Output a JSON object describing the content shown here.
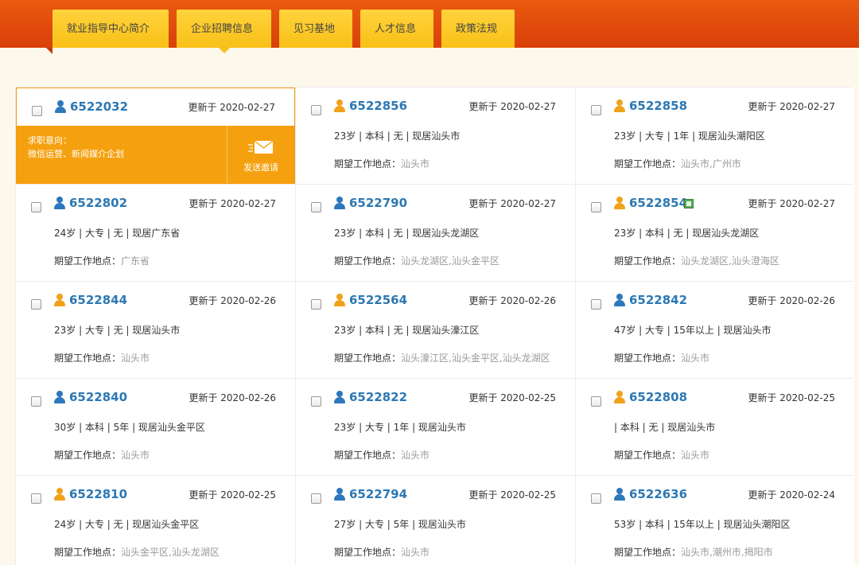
{
  "nav": {
    "tabs": [
      {
        "label": "就业指导中心简介"
      },
      {
        "label": "企业招聘信息"
      },
      {
        "label": "见习基地"
      },
      {
        "label": "人才信息"
      },
      {
        "label": "政策法规"
      }
    ]
  },
  "colors": {
    "accent": "#f5a10f",
    "nav_bg": "#e14d0c",
    "tab_bg": "#ffc61f",
    "id_link": "#2c78b3"
  },
  "active_card": {
    "intent_label": "求职意向：",
    "intent_value": "微信运营、新闻媒介企划",
    "send_label": "发送邀请",
    "send_icon": "envelope-icon"
  },
  "location_label": "期望工作地点：",
  "cards": [
    {
      "id": "6522032",
      "updated": "更新于 2020-02-27",
      "avatar": "blue",
      "info": "",
      "location": ""
    },
    {
      "id": "6522856",
      "updated": "更新于 2020-02-27",
      "avatar": "orange",
      "info": "23岁 | 本科 | 无 | 现居汕头市",
      "location": "汕头市"
    },
    {
      "id": "6522858",
      "updated": "更新于 2020-02-27",
      "avatar": "orange",
      "info": "23岁 | 大专 | 1年 | 现居汕头潮阳区",
      "location": "汕头市,广州市"
    },
    {
      "id": "6522802",
      "updated": "更新于 2020-02-27",
      "avatar": "blue",
      "info": "24岁 | 大专 | 无 | 现居广东省",
      "location": "广东省"
    },
    {
      "id": "6522790",
      "updated": "更新于 2020-02-27",
      "avatar": "blue",
      "info": "23岁 | 本科 | 无 | 现居汕头龙湖区",
      "location": "汕头龙湖区,汕头金平区"
    },
    {
      "id": "6522854",
      "updated": "更新于 2020-02-27",
      "avatar": "orange",
      "info": "23岁 | 本科 | 无 | 现居汕头龙湖区",
      "location": "汕头龙湖区,汕头澄海区",
      "has_doc": true
    },
    {
      "id": "6522844",
      "updated": "更新于 2020-02-26",
      "avatar": "orange",
      "info": "23岁 | 大专 | 无 | 现居汕头市",
      "location": "汕头市"
    },
    {
      "id": "6522564",
      "updated": "更新于 2020-02-26",
      "avatar": "orange",
      "info": "23岁 | 本科 | 无 | 现居汕头濠江区",
      "location": "汕头濠江区,汕头金平区,汕头龙湖区"
    },
    {
      "id": "6522842",
      "updated": "更新于 2020-02-26",
      "avatar": "blue",
      "info": "47岁 | 大专 | 15年以上 | 现居汕头市",
      "location": "汕头市"
    },
    {
      "id": "6522840",
      "updated": "更新于 2020-02-26",
      "avatar": "blue",
      "info": "30岁 | 本科 | 5年 | 现居汕头金平区",
      "location": "汕头市"
    },
    {
      "id": "6522822",
      "updated": "更新于 2020-02-25",
      "avatar": "blue",
      "info": "23岁 | 大专 | 1年 | 现居汕头市",
      "location": "汕头市"
    },
    {
      "id": "6522808",
      "updated": "更新于 2020-02-25",
      "avatar": "orange",
      "info": " | 本科 | 无 | 现居汕头市",
      "location": "汕头市"
    },
    {
      "id": "6522810",
      "updated": "更新于 2020-02-25",
      "avatar": "orange",
      "info": "24岁 | 大专 | 无 | 现居汕头金平区",
      "location": "汕头金平区,汕头龙湖区"
    },
    {
      "id": "6522794",
      "updated": "更新于 2020-02-25",
      "avatar": "blue",
      "info": "27岁 | 大专 | 5年 | 现居汕头市",
      "location": "汕头市"
    },
    {
      "id": "6522636",
      "updated": "更新于 2020-02-24",
      "avatar": "blue",
      "info": "53岁 | 本科 | 15年以上 | 现居汕头潮阳区",
      "location": "汕头市,潮州市,揭阳市"
    }
  ]
}
